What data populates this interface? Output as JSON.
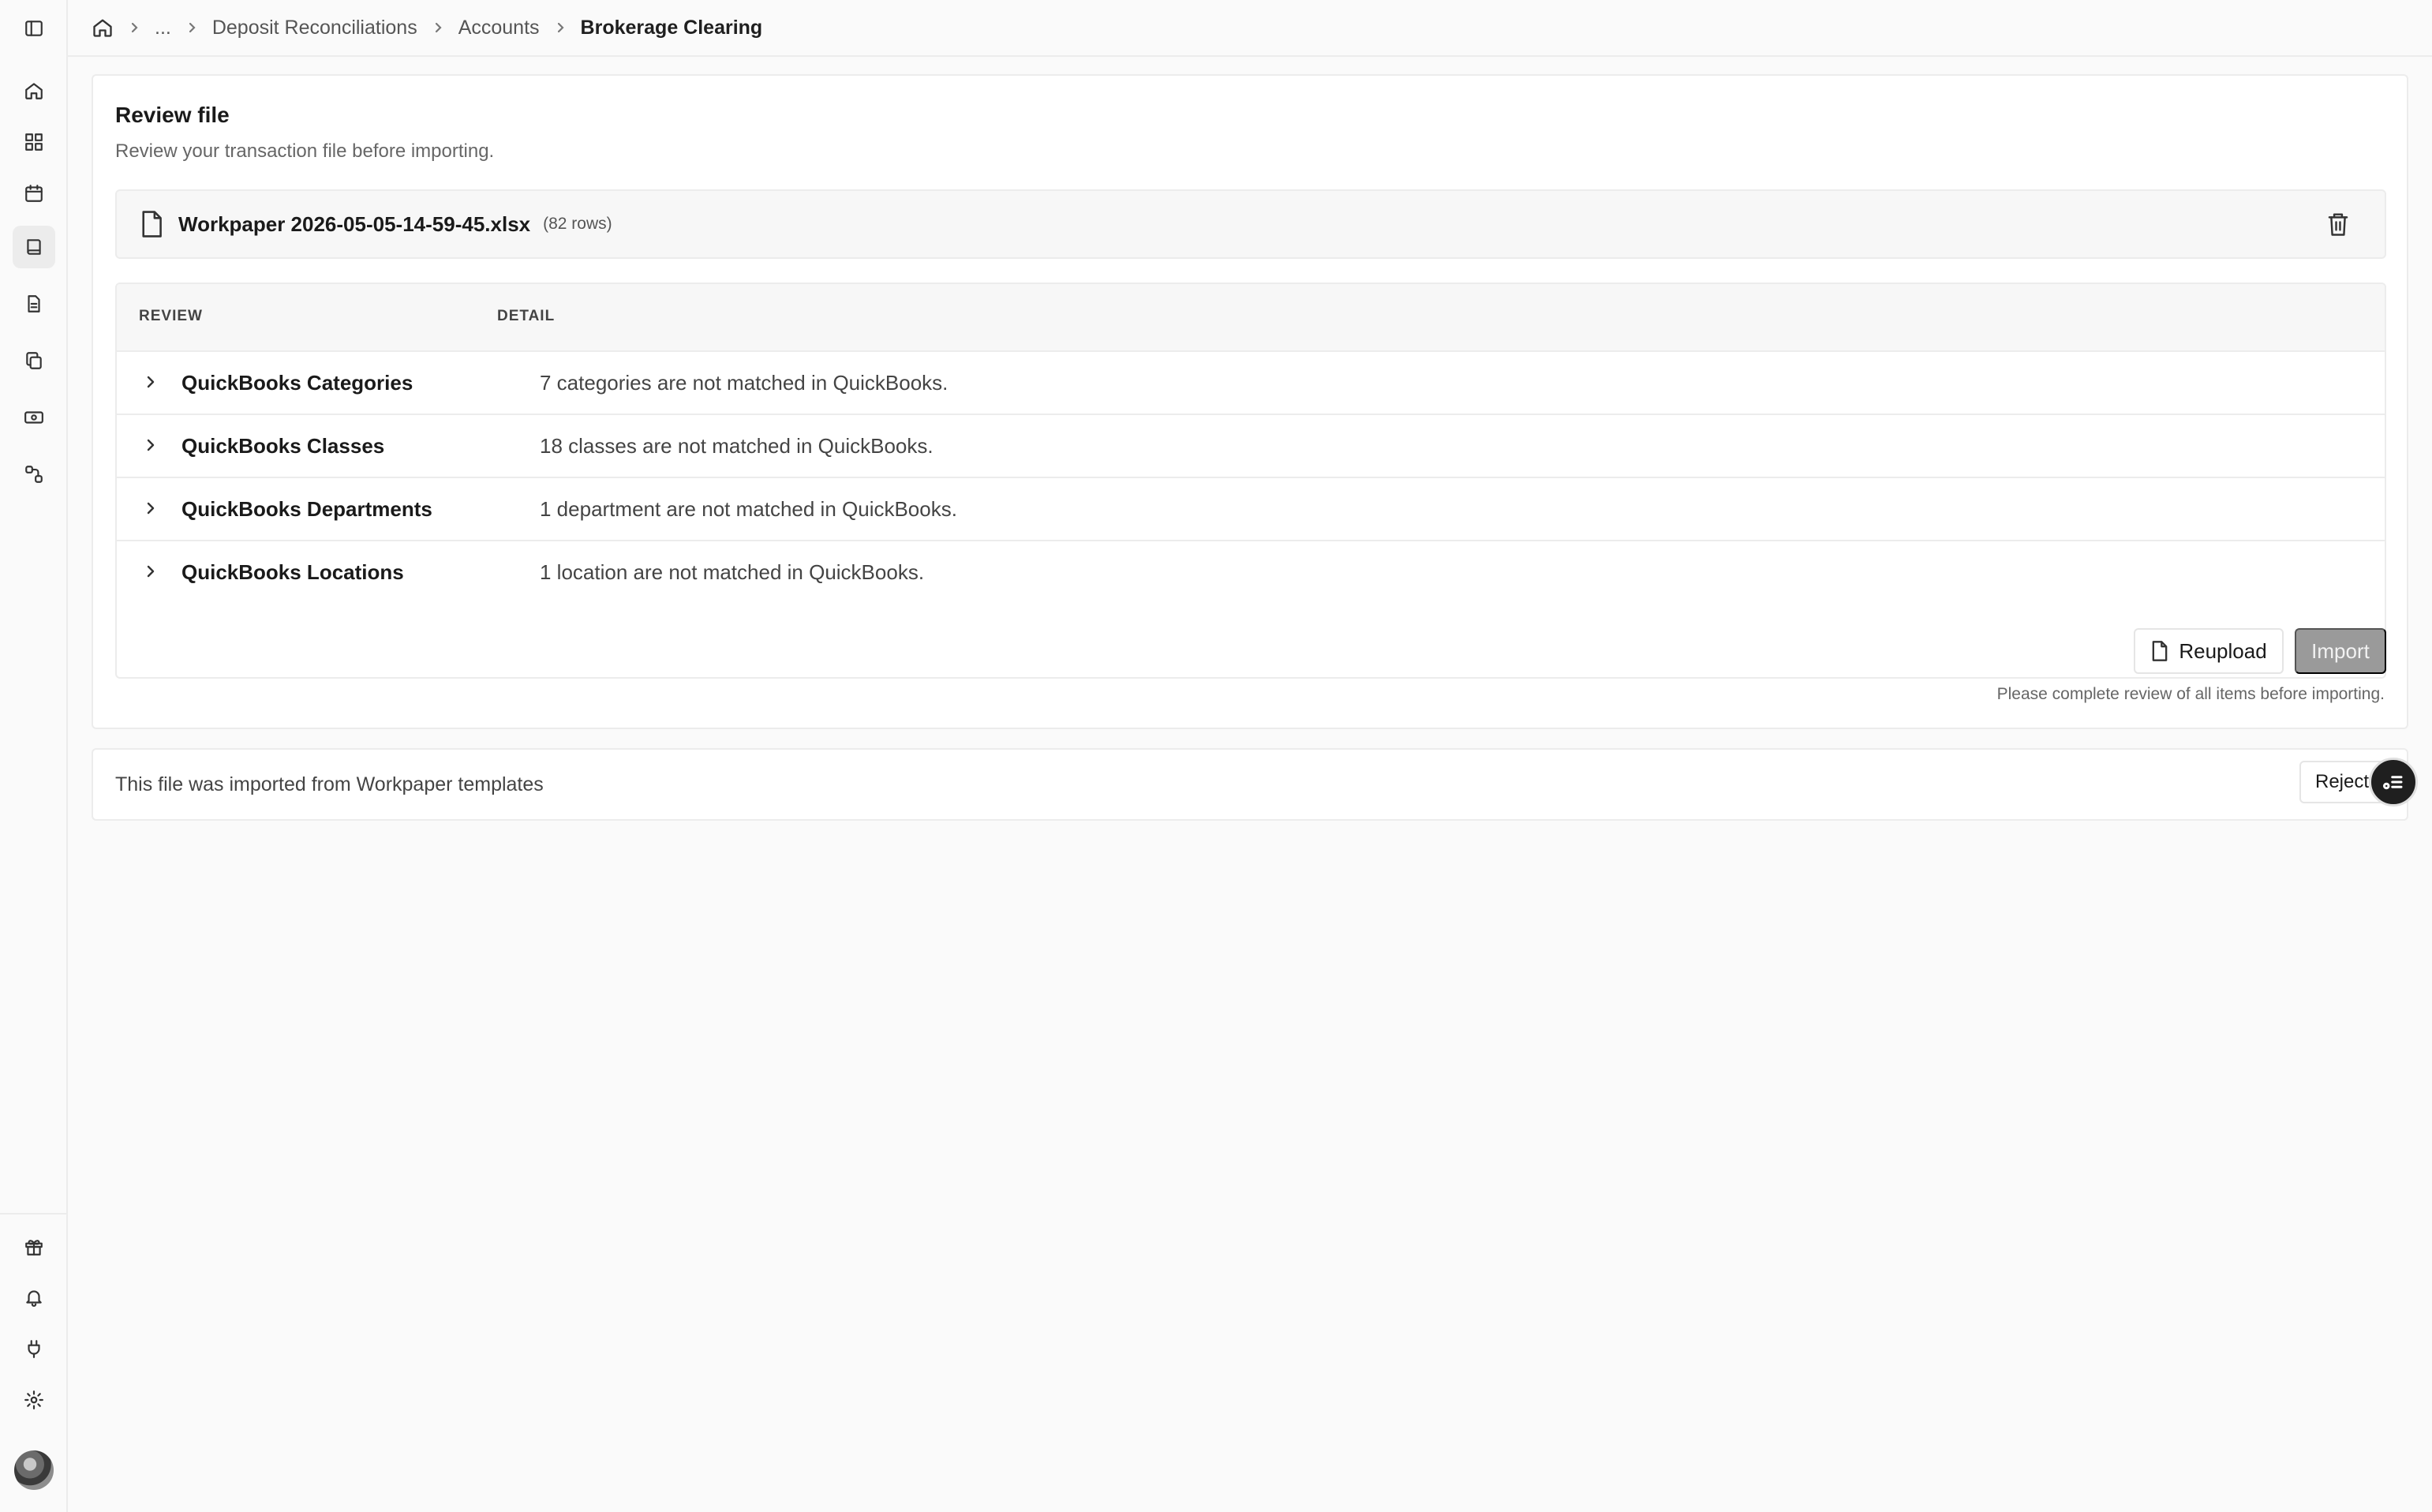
{
  "sidebar": {
    "top_items": [
      {
        "name": "sidebar-toggle-icon"
      },
      {
        "name": "home-icon"
      },
      {
        "name": "dashboard-icon"
      },
      {
        "name": "calendar-icon"
      },
      {
        "name": "book-icon"
      },
      {
        "name": "document-icon"
      },
      {
        "name": "copy-icon"
      },
      {
        "name": "banknote-icon"
      },
      {
        "name": "workflow-icon"
      }
    ],
    "bottom_items": [
      {
        "name": "gift-icon"
      },
      {
        "name": "bell-icon"
      },
      {
        "name": "plug-icon"
      },
      {
        "name": "gear-icon"
      }
    ]
  },
  "breadcrumb": {
    "ellipsis": "...",
    "items": [
      "Deposit Reconciliations",
      "Accounts",
      "Brokerage Clearing"
    ]
  },
  "review": {
    "title": "Review file",
    "subtitle": "Review your transaction file before importing.",
    "file": {
      "name": "Workpaper 2026-05-05-14-59-45.xlsx",
      "rows": "(82 rows)"
    },
    "table": {
      "headers": [
        "REVIEW",
        "DETAIL"
      ],
      "rows": [
        {
          "name": "QuickBooks Categories",
          "detail": "7 categories are not matched in QuickBooks."
        },
        {
          "name": "QuickBooks Classes",
          "detail": "18 classes are not matched in QuickBooks."
        },
        {
          "name": "QuickBooks Departments",
          "detail": "1 department are not matched in QuickBooks."
        },
        {
          "name": "QuickBooks Locations",
          "detail": "1 location are not matched in QuickBooks."
        }
      ]
    },
    "reupload_label": "Reupload",
    "import_label": "Import",
    "note": "Please complete review of all items before importing."
  },
  "source": {
    "text": "This file was imported from Workpaper templates",
    "reject_label": "Reject"
  },
  "colors": {
    "import_disabled": "#9a9a9a",
    "fab": "#1f1f1f"
  }
}
